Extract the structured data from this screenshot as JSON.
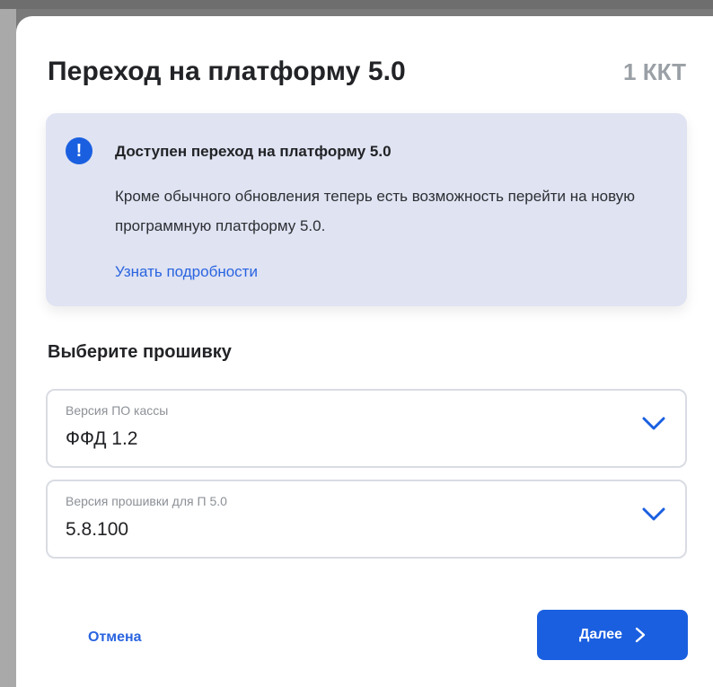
{
  "dialog": {
    "title": "Переход на платформу 5.0",
    "count": "1 ККТ"
  },
  "info": {
    "icon": "exclamation-icon",
    "title": "Доступен переход на платформу 5.0",
    "text": "Кроме обычного обновления теперь есть возможность перейти на новую программную платформу 5.0.",
    "link_label": "Узнать подробности"
  },
  "firmware": {
    "section_title": "Выберите прошивку",
    "selects": [
      {
        "label": "Версия ПО кассы",
        "value": "ФФД 1.2"
      },
      {
        "label": "Версия прошивки для П 5.0",
        "value": "5.8.100"
      }
    ]
  },
  "actions": {
    "cancel_label": "Отмена",
    "next_label": "Далее"
  },
  "colors": {
    "accent": "#1a5fe0",
    "info_bg": "#dfe3f2",
    "muted": "#9aa0a6"
  }
}
